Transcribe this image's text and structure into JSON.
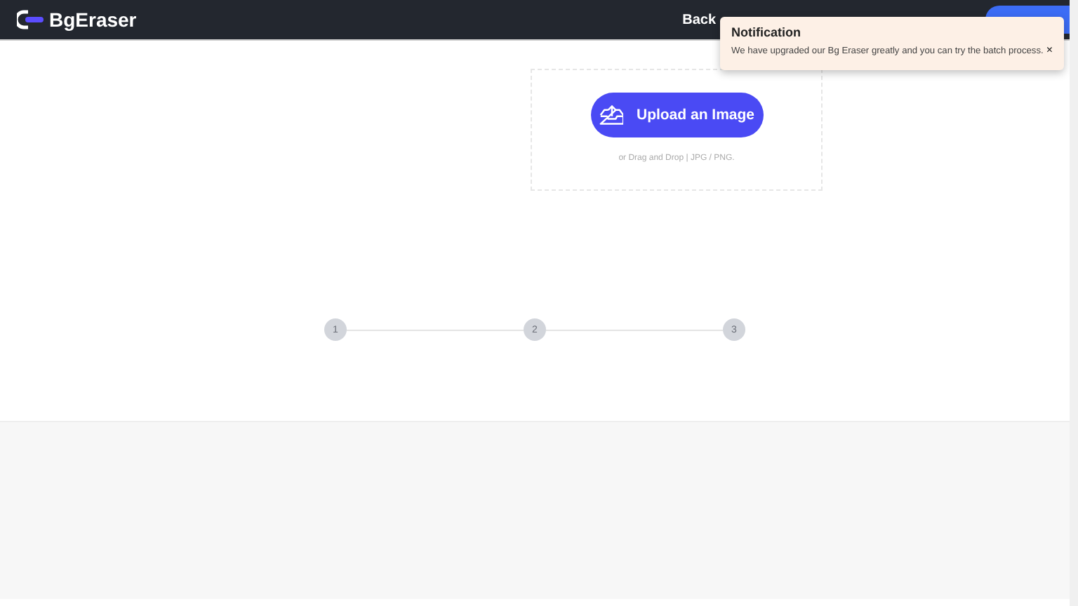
{
  "header": {
    "logo": "BgEraser",
    "nav": [
      "Back"
    ]
  },
  "notification": {
    "title": "Notification",
    "message": "We have upgraded our Bg Eraser greatly and you can try the batch process.",
    "close": "×"
  },
  "upload": {
    "button": "Upload an Image",
    "hint": "or Drag and Drop | JPG / PNG."
  },
  "steps": [
    "1",
    "2",
    "3"
  ]
}
